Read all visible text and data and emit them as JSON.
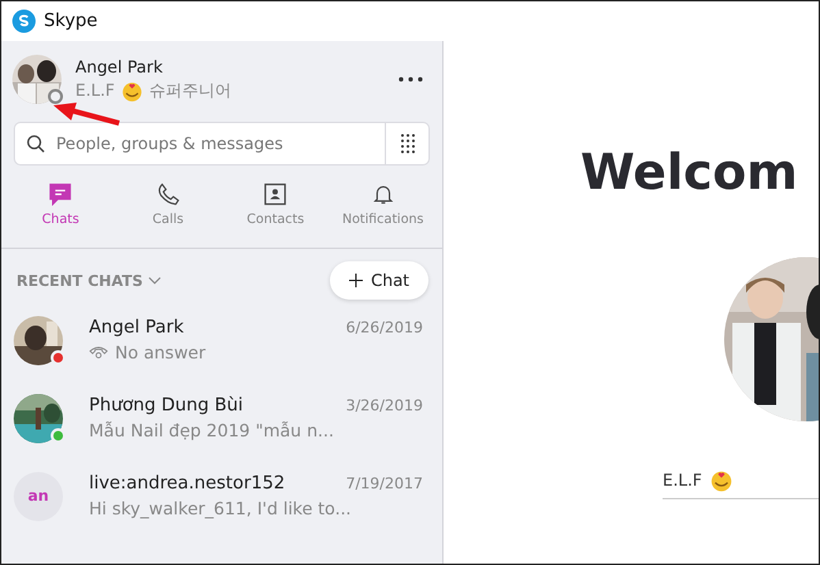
{
  "window": {
    "title": "Skype"
  },
  "profile": {
    "name": "Angel Park",
    "status_prefix": "E.L.F",
    "status_suffix": "슈퍼주니어"
  },
  "search": {
    "placeholder": "People, groups & messages"
  },
  "tabs": [
    {
      "label": "Chats",
      "kind": "chats",
      "selected": true
    },
    {
      "label": "Calls",
      "kind": "calls",
      "selected": false
    },
    {
      "label": "Contacts",
      "kind": "contacts",
      "selected": false
    },
    {
      "label": "Notifications",
      "kind": "notifications",
      "selected": false
    }
  ],
  "recent": {
    "heading": "RECENT CHATS",
    "new_chat": "Chat"
  },
  "chats": [
    {
      "name": "Angel Park",
      "date": "6/26/2019",
      "preview": "No answer",
      "kind": "call",
      "color": "#e5302e"
    },
    {
      "name": "Phương Dung Bùi",
      "date": "3/26/2019",
      "preview": "Mẫu Nail đẹp 2019  \"mẫu n...",
      "kind": "message",
      "color": "#3dbb3d"
    },
    {
      "name": "live:andrea.nestor152",
      "date": "7/19/2017",
      "preview": "Hi sky_walker_611, I'd like to...",
      "kind": "message",
      "initials": "an"
    }
  ],
  "welcome": {
    "heading": "Welcom",
    "status_prefix": "E.L.F"
  }
}
